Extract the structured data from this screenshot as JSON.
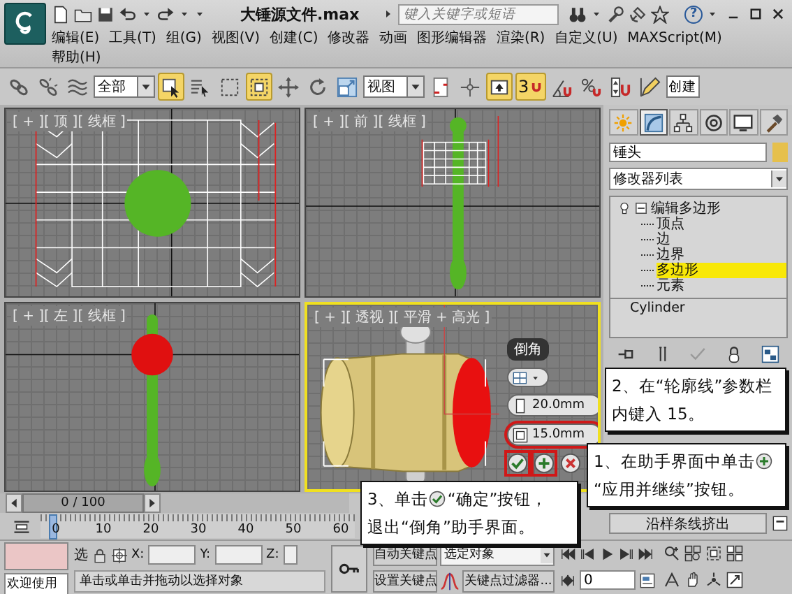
{
  "title_bar": {
    "file_title": "大锤源文件.max",
    "search": {
      "placeholder": "键入关键字或短语"
    },
    "help": "?"
  },
  "menu_rows": [
    [
      "编辑(E)",
      "工具(T)",
      "组(G)",
      "视图(V)",
      "创建(C)",
      "修改器",
      "动画",
      "图形编辑器",
      "渲染(R)",
      "自定义(U)",
      "MAXScript(M)"
    ],
    [
      "帮助(H)"
    ]
  ],
  "toolbar": [
    {
      "kind": "link",
      "on": false
    },
    {
      "kind": "unlink",
      "on": false
    },
    {
      "kind": "bind",
      "on": false
    },
    {
      "kind": "filter",
      "value": "全部"
    },
    {
      "kind": "select",
      "on": true
    },
    {
      "kind": "select_by_name",
      "on": false
    },
    {
      "kind": "region",
      "on": false
    },
    {
      "kind": "crossing",
      "on": true
    },
    {
      "kind": "move",
      "on": false
    },
    {
      "kind": "rotate",
      "on": false
    },
    {
      "kind": "scale",
      "on": false
    },
    {
      "kind": "coord",
      "value": "视图"
    },
    {
      "kind": "pivot",
      "on": false
    },
    {
      "kind": "manipulate",
      "on": false
    },
    {
      "kind": "shortcut",
      "on": true
    },
    {
      "kind": "snap",
      "value": "3",
      "on": true
    },
    {
      "kind": "angle_snap",
      "on": false
    },
    {
      "kind": "percent_snap",
      "on": false
    },
    {
      "kind": "spinner_snap",
      "on": false
    },
    {
      "kind": "edit_named",
      "on": false
    },
    {
      "kind": "named_field",
      "value": "创建"
    }
  ],
  "viewports": [
    {
      "label": "[ + ][ 顶 ][ 线框 ]",
      "kind": "top",
      "selected": false
    },
    {
      "label": "[ + ][ 前 ][ 线框 ]",
      "kind": "front",
      "selected": false
    },
    {
      "label": "[ + ][ 左 ][ 线框 ]",
      "kind": "left",
      "selected": false
    },
    {
      "label": "[ + ][ 透视 ][ 平滑 + 高光 ]",
      "kind": "perspective",
      "selected": true
    }
  ],
  "caddy": {
    "title": "倒角",
    "height": "20.0mm",
    "outline": "15.0mm"
  },
  "command_panel": {
    "tabs": [
      {
        "kind": "create",
        "selected": false
      },
      {
        "kind": "modify",
        "selected": true
      },
      {
        "kind": "hierarchy",
        "selected": false
      },
      {
        "kind": "motion",
        "selected": false
      },
      {
        "kind": "display",
        "selected": false
      },
      {
        "kind": "utilities",
        "selected": false
      }
    ],
    "object_name": "锤头",
    "modifier_list": "修改器列表",
    "stack": {
      "label": "编辑多边形",
      "expanded": true,
      "children": [
        {
          "label": "顶点",
          "selected": false
        },
        {
          "label": "边",
          "selected": false
        },
        {
          "label": "边界",
          "selected": false
        },
        {
          "label": "多边形",
          "selected": true
        },
        {
          "label": "元素",
          "selected": false
        }
      ]
    },
    "base_object": "Cylinder",
    "button": "沿样条线挤出"
  },
  "time_slider": {
    "position": "0 / 100",
    "ticks": [
      "0",
      "10",
      "20",
      "30",
      "40",
      "50",
      "60"
    ]
  },
  "status": {
    "welcome": "欢迎使用",
    "selection_button": "选",
    "x_label": "X:",
    "y_label": "Y:",
    "z_label": "Z:",
    "prompt": "单击或单击并拖动以选择对象",
    "auto_key": "自动关键点",
    "set_key": "设置关键点",
    "key_target": "选定对象",
    "key_filters": "关键点过滤器...",
    "frame": "0"
  },
  "callouts": [
    {
      "kind": "text",
      "before": "2、在“轮廓线”参数栏内键入 15。"
    },
    {
      "kind": "apply_icon",
      "before": "1、在助手界面中单击",
      "line2": "“应用并继续”按钮。"
    },
    {
      "kind": "ok_icon",
      "before": "3、单击",
      "after": "“确定”按钮，",
      "line2": "退出“倒角”助手界面。"
    }
  ]
}
